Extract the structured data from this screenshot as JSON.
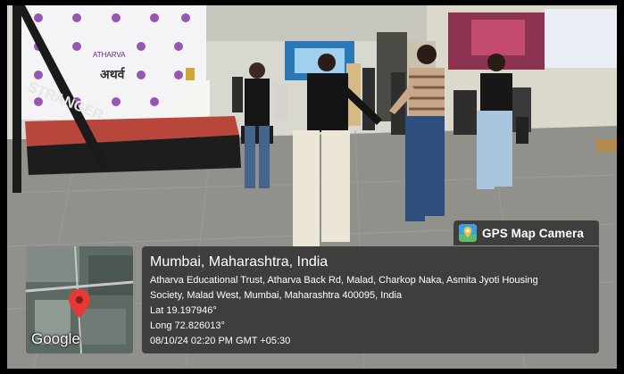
{
  "photo": {
    "description_free": true,
    "backdrop_brand": "ATHARVA",
    "backdrop_hindi": "अथर्व",
    "banner_text": "STRANGER"
  },
  "map": {
    "provider_label": "Google",
    "pin_color": "#e53935"
  },
  "gps_badge": {
    "title": "GPS Map Camera"
  },
  "location": {
    "city_line": "Mumbai, Maharashtra, India",
    "address_line1": "Atharva Educational Trust, Atharva Back Rd, Malad, Charkop Naka, Asmita Jyoti Housing",
    "address_line2": "Society, Malad West, Mumbai, Maharashtra 400095, India",
    "latitude": "Lat 19.197946°",
    "longitude": "Long 72.826013°",
    "timestamp": "08/10/24 02:20 PM GMT +05:30"
  },
  "colors": {
    "overlay_bg": "#282828",
    "stage_red": "#b8463a",
    "floor": "#8d8f88"
  }
}
